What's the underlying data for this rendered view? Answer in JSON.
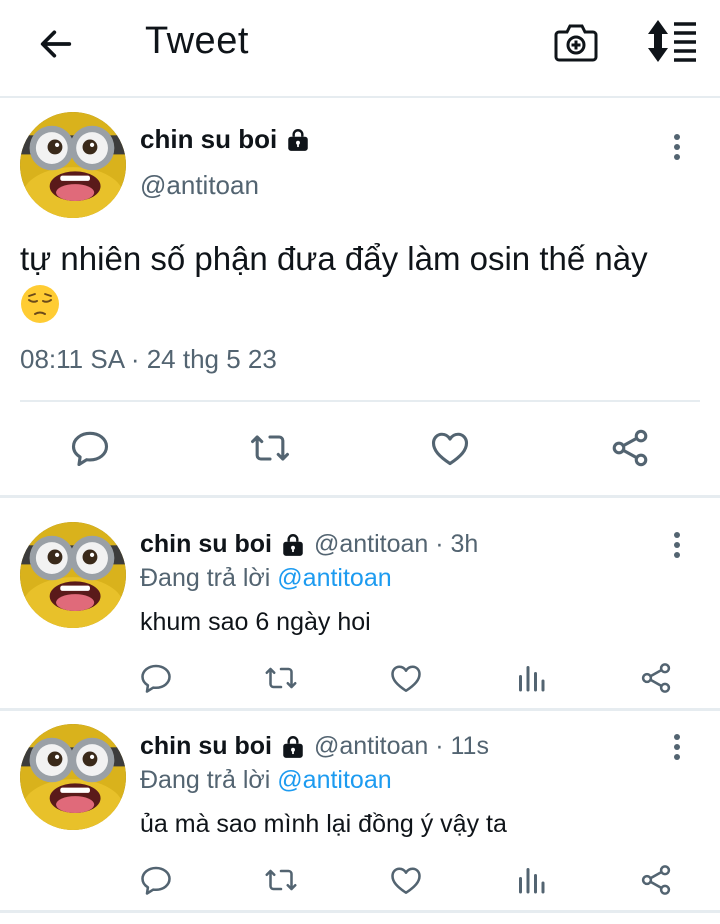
{
  "header": {
    "title": "Tweet",
    "back_icon": "arrow-left-icon",
    "camera_icon": "camera-plus-icon",
    "sort_icon": "sort-list-icon"
  },
  "main_tweet": {
    "name": "chin su boi",
    "handle": "@antitoan",
    "text": "tự nhiên số phận đưa đẩy làm osin thế này",
    "emoji": "pensive-face",
    "timestamp": "08:11 SA · 24 thg 5 23",
    "actions": [
      "reply-icon",
      "retweet-icon",
      "like-icon",
      "share-icon"
    ]
  },
  "replies": [
    {
      "name": "chin su boi",
      "handle": "@antitoan · 3h",
      "replying_prefix": "Đang trả lời ",
      "replying_to": "@antitoan",
      "text": "khum sao 6 ngày hoi"
    },
    {
      "name": "chin su boi",
      "handle": "@antitoan · 11s",
      "replying_prefix": "Đang trả lời ",
      "replying_to": "@antitoan",
      "text": "ủa mà sao mình lại đồng ý vậy ta"
    }
  ],
  "colors": {
    "text": "#0f1419",
    "secondary": "#536471",
    "accent": "#1d9bf0",
    "divider": "#e6ecf0"
  }
}
